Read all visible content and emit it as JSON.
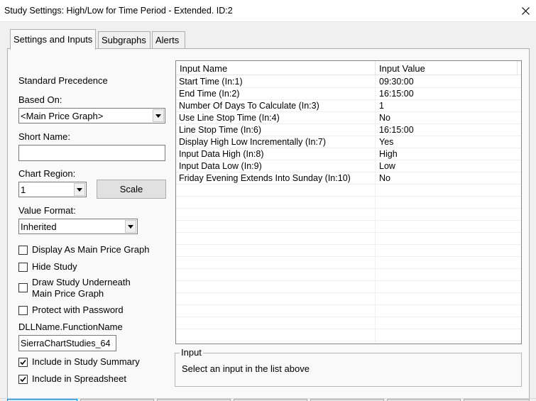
{
  "window": {
    "title": "Study Settings: High/Low for Time Period - Extended. ID:2",
    "close_icon": "close-icon"
  },
  "tabs": [
    {
      "label": "Settings and Inputs",
      "active": true
    },
    {
      "label": "Subgraphs",
      "active": false
    },
    {
      "label": "Alerts",
      "active": false
    }
  ],
  "settings": {
    "standard_precedence": "Standard Precedence",
    "based_on_label": "Based On:",
    "based_on_value": "<Main Price Graph>",
    "short_name_label": "Short Name:",
    "short_name_value": "",
    "chart_region_label": "Chart Region:",
    "chart_region_value": "1",
    "scale_button": "Scale",
    "value_format_label": "Value Format:",
    "value_format_value": "Inherited",
    "checkboxes": [
      {
        "label": "Display As Main Price Graph",
        "checked": false
      },
      {
        "label": "Hide Study",
        "checked": false
      },
      {
        "label": "Draw Study Underneath",
        "label2": "Main Price Graph",
        "checked": false
      },
      {
        "label": "Protect with Password",
        "checked": false
      }
    ],
    "dll_label": "DLLName.FunctionName",
    "dll_value": "SierraChartStudies_64",
    "include_summary": {
      "label": "Include in Study Summary",
      "checked": true
    },
    "include_spreadsheet": {
      "label": "Include in Spreadsheet",
      "checked": true
    }
  },
  "inputs_table": {
    "columns": [
      "Input Name",
      "Input Value"
    ],
    "rows": [
      {
        "name": "Start Time   (In:1)",
        "value": "09:30:00"
      },
      {
        "name": "End Time   (In:2)",
        "value": "16:15:00"
      },
      {
        "name": "Number Of Days To Calculate   (In:3)",
        "value": "1"
      },
      {
        "name": "Use Line Stop Time   (In:4)",
        "value": "No"
      },
      {
        "name": "Line Stop Time   (In:6)",
        "value": "16:15:00"
      },
      {
        "name": "Display High Low Incrementally   (In:7)",
        "value": "Yes"
      },
      {
        "name": "Input Data High   (In:8)",
        "value": "High"
      },
      {
        "name": "Input Data Low   (In:9)",
        "value": "Low"
      },
      {
        "name": "Friday Evening Extends Into Sunday   (In:10)",
        "value": "No"
      }
    ]
  },
  "input_group": {
    "title": "Input",
    "text": "Select an input in the list above"
  }
}
